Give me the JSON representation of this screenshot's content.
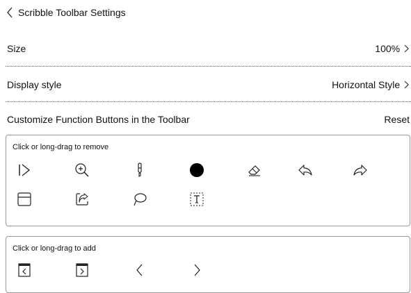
{
  "header": {
    "title": "Scribble Toolbar Settings",
    "back_icon": "chevron-left-icon"
  },
  "settings": {
    "size": {
      "label": "Size",
      "value": "100%"
    },
    "display_style": {
      "label": "Display style",
      "value": "Horizontal Style"
    },
    "customize": {
      "label": "Customize Function Buttons in the Toolbar",
      "reset": "Reset"
    }
  },
  "remove_panel": {
    "label": "Click or long-drag to remove",
    "icons": [
      "collapse-toolbar-icon",
      "zoom-in-icon",
      "pen-icon",
      "color-dot-icon",
      "eraser-icon",
      "undo-icon",
      "redo-icon",
      "save-icon",
      "share-icon",
      "lasso-icon",
      "text-box-icon"
    ]
  },
  "add_panel": {
    "label": "Click or long-drag to add",
    "icons": [
      "previous-page-icon",
      "next-page-icon",
      "chevron-left-icon",
      "chevron-right-icon"
    ]
  }
}
